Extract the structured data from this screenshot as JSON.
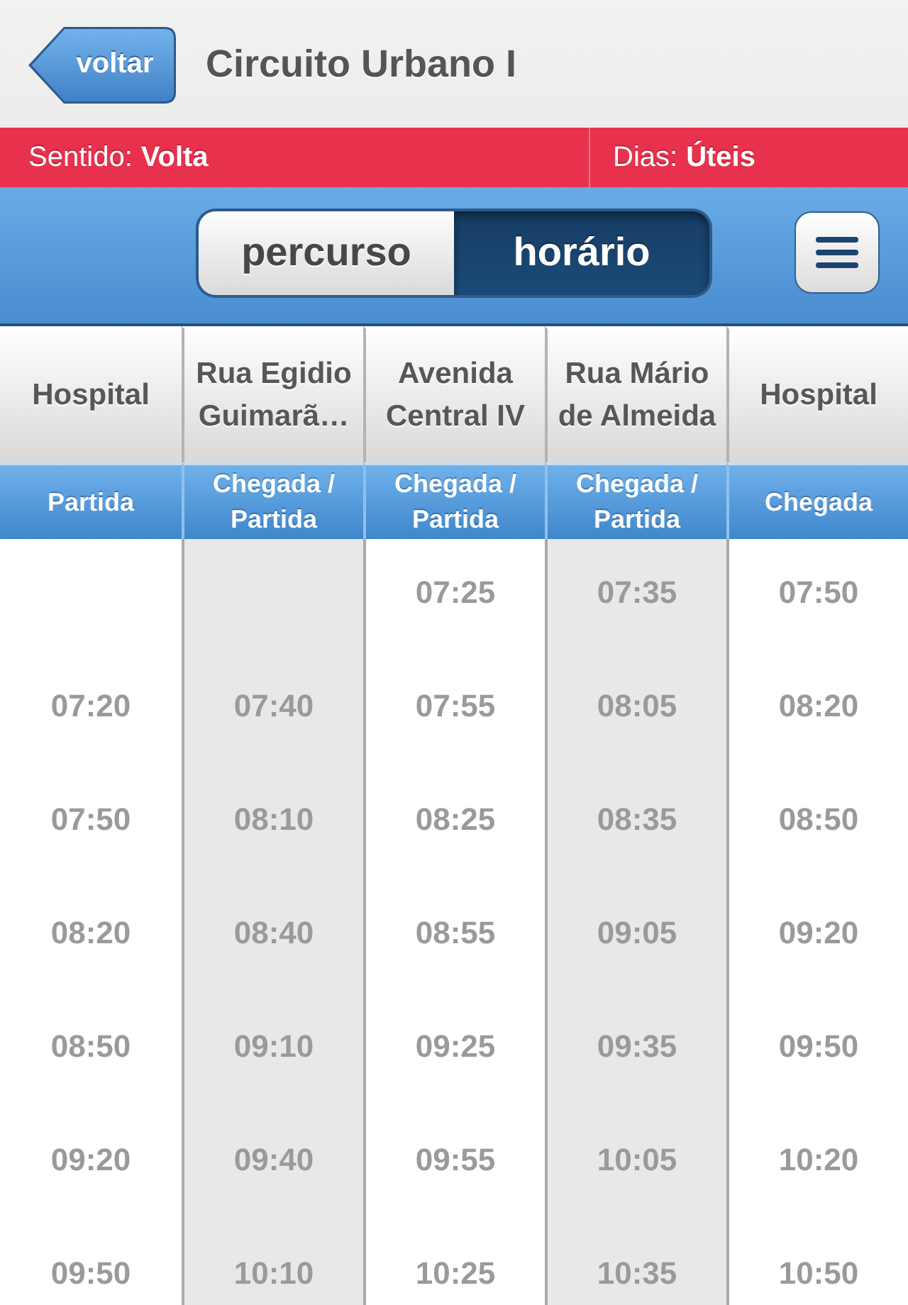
{
  "header": {
    "back_button": "voltar",
    "title": "Circuito Urbano I"
  },
  "info_bar": [
    {
      "label": "Sentido:",
      "value": "Volta"
    },
    {
      "label": "Dias:",
      "value": "Úteis"
    }
  ],
  "view_toggle": [
    {
      "label": "percurso",
      "selected": false
    },
    {
      "label": "horário",
      "selected": true
    }
  ],
  "table": {
    "columns": [
      {
        "stop": "Hospital",
        "type": "Partida"
      },
      {
        "stop": "Rua Egidio Guimarã…",
        "type": "Chegada / Partida"
      },
      {
        "stop": "Avenida Central IV",
        "type": "Chegada / Partida"
      },
      {
        "stop": "Rua Mário de Almeida",
        "type": "Chegada / Partida"
      },
      {
        "stop": "Hospital",
        "type": "Chegada"
      }
    ],
    "rows": [
      [
        null,
        null,
        "07:25",
        "07:35",
        "07:50"
      ],
      [
        "07:20",
        "07:40",
        "07:55",
        "08:05",
        "08:20"
      ],
      [
        "07:50",
        "08:10",
        "08:25",
        "08:35",
        "08:50"
      ],
      [
        "08:20",
        "08:40",
        "08:55",
        "09:05",
        "09:20"
      ],
      [
        "08:50",
        "09:10",
        "09:25",
        "09:35",
        "09:50"
      ],
      [
        "09:20",
        "09:40",
        "09:55",
        "10:05",
        "10:20"
      ],
      [
        "09:50",
        "10:10",
        "10:25",
        "10:35",
        "10:50"
      ]
    ]
  }
}
